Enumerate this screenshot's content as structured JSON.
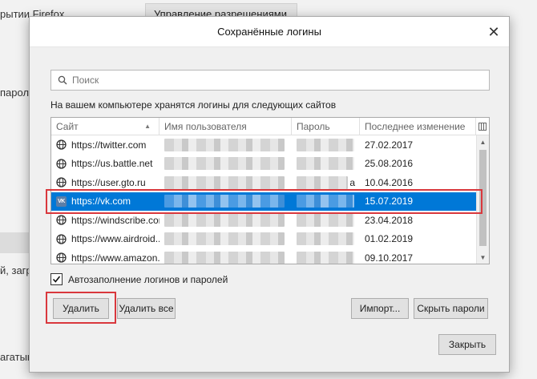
{
  "background": {
    "text1": "рытии Firefox",
    "button": "Управление разрешениями...",
    "text2": "пароле",
    "text3": "й, загр",
    "text4": "агатыь"
  },
  "dialog": {
    "title": "Сохранённые логины",
    "search_placeholder": "Поиск",
    "description": "На вашем компьютере хранятся логины для следующих сайтов",
    "columns": {
      "site": "Сайт",
      "username": "Имя пользователя",
      "password": "Пароль",
      "last_changed": "Последнее изменение"
    },
    "rows": [
      {
        "site": "https://twitter.com",
        "date": "27.02.2017",
        "icon": "globe-icon"
      },
      {
        "site": "https://us.battle.net",
        "date": "25.08.2016",
        "icon": "globe-icon"
      },
      {
        "site": "https://user.gto.ru",
        "date": "10.04.2016",
        "icon": "globe-icon",
        "overflow": "а"
      },
      {
        "site": "https://vk.com",
        "date": "15.07.2019",
        "icon": "vk-icon",
        "icon_text": "VK"
      },
      {
        "site": "https://windscribe.com",
        "date": "23.04.2018",
        "icon": "globe-icon"
      },
      {
        "site": "https://www.airdroid....",
        "date": "01.02.2019",
        "icon": "globe-icon"
      },
      {
        "site": "https://www.amazon.ca",
        "date": "09.10.2017",
        "icon": "globe-icon"
      }
    ],
    "autofill_label": "Автозаполнение логинов и паролей",
    "autofill_checked": true,
    "buttons": {
      "delete": "Удалить",
      "delete_all": "Удалить все",
      "import": "Импорт...",
      "hide_passwords": "Скрыть пароли",
      "close": "Закрыть"
    }
  },
  "colors": {
    "selection": "#0078d7",
    "highlight": "#d9383d"
  }
}
